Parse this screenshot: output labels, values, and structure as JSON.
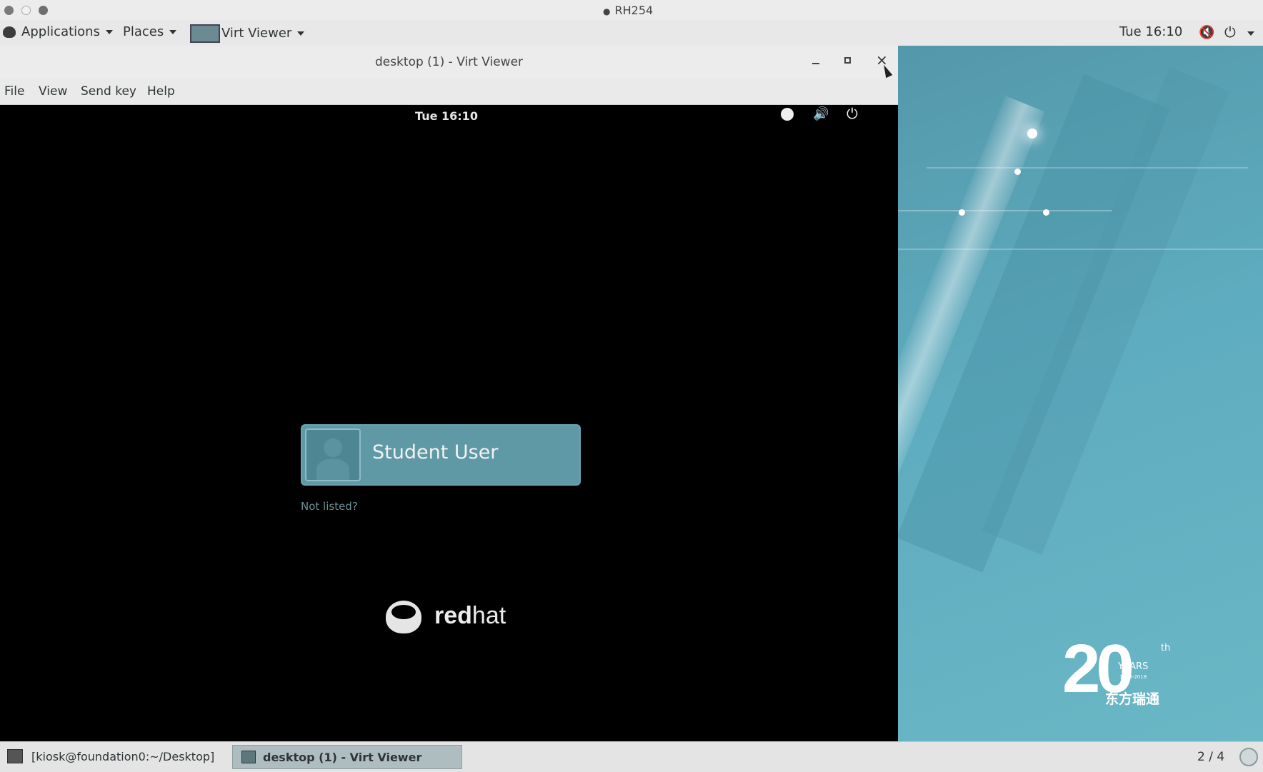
{
  "system": {
    "window_title": "RH254",
    "menu": {
      "applications": "Applications",
      "places": "Places",
      "app_name": "Virt Viewer"
    },
    "clock": "Tue 16:10"
  },
  "virt_viewer": {
    "title": "desktop (1) - Virt Viewer",
    "menu": {
      "file": "File",
      "view": "View",
      "send_key": "Send key",
      "help": "Help"
    }
  },
  "guest": {
    "clock": "Tue 16:10",
    "user_name": "Student User",
    "not_listed": "Not listed?",
    "logo_red": "red",
    "logo_hat": "hat"
  },
  "desktop_logo": {
    "number": "20",
    "suffix": "th",
    "years": "YEARS",
    "range": "1998-2018",
    "company": "东方瑞通"
  },
  "taskbar": {
    "tasks": [
      "[kiosk@foundation0:~/Desktop]",
      "desktop (1) - Virt Viewer"
    ],
    "workspace": "2 / 4"
  },
  "colors": {
    "desktop": "#5aa7b8",
    "guest_card": "#5f99a6"
  }
}
